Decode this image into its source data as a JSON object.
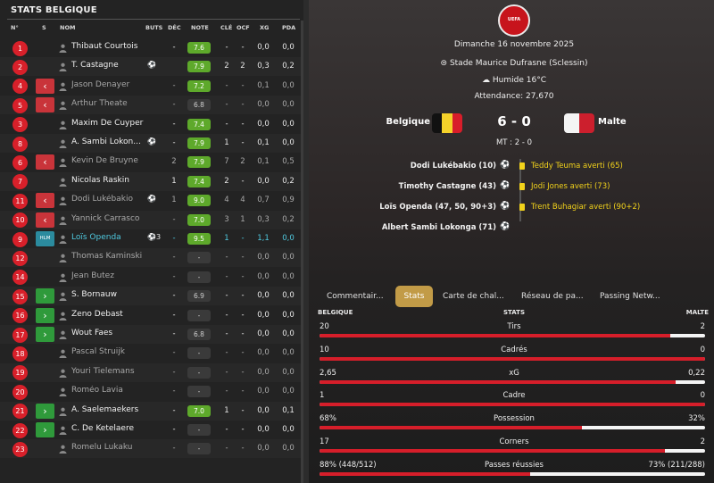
{
  "left_panel": {
    "title": "STATS BELGIQUE",
    "columns": {
      "num": "N°",
      "sub": "S",
      "name": "NOM",
      "buts": "BUTS",
      "dec": "DÉC",
      "note": "NOTE",
      "cle": "CLÉ",
      "ocf": "OCF",
      "xg": "XG",
      "pda": "PDA"
    },
    "players": [
      {
        "num": "1",
        "sub": "",
        "name": "Thibaut Courtois",
        "buts": "",
        "dec": "-",
        "note": "7.6",
        "note_style": "green",
        "cle": "-",
        "ocf": "-",
        "xg": "0,0",
        "pda": "0,0",
        "state": "normal"
      },
      {
        "num": "2",
        "sub": "",
        "name": "T. Castagne",
        "buts": "⚽",
        "dec": "",
        "note": "7.9",
        "note_style": "green",
        "cle": "2",
        "ocf": "2",
        "xg": "0,3",
        "pda": "0,2",
        "state": "normal"
      },
      {
        "num": "4",
        "sub": "out",
        "name": "Jason Denayer",
        "buts": "",
        "dec": "-",
        "note": "7.2",
        "note_style": "green",
        "cle": "-",
        "ocf": "-",
        "xg": "0,1",
        "pda": "0,0",
        "state": "dim"
      },
      {
        "num": "5",
        "sub": "out",
        "name": "Arthur Theate",
        "buts": "",
        "dec": "-",
        "note": "6.8",
        "note_style": "grey",
        "cle": "-",
        "ocf": "-",
        "xg": "0,0",
        "pda": "0,0",
        "state": "dim"
      },
      {
        "num": "3",
        "sub": "",
        "name": "Maxim De Cuyper",
        "buts": "",
        "dec": "-",
        "note": "7.4",
        "note_style": "green",
        "cle": "-",
        "ocf": "-",
        "xg": "0,0",
        "pda": "0,0",
        "state": "normal"
      },
      {
        "num": "8",
        "sub": "",
        "name": "A. Sambi Lokon...",
        "buts": "⚽",
        "dec": "-",
        "note": "7.9",
        "note_style": "green",
        "cle": "1",
        "ocf": "-",
        "xg": "0,1",
        "pda": "0,0",
        "state": "normal"
      },
      {
        "num": "6",
        "sub": "out",
        "name": "Kevin De Bruyne",
        "buts": "",
        "dec": "2",
        "note": "7.9",
        "note_style": "green",
        "cle": "7",
        "ocf": "2",
        "xg": "0,1",
        "pda": "0,5",
        "state": "dim"
      },
      {
        "num": "7",
        "sub": "",
        "name": "Nicolas Raskin",
        "buts": "",
        "dec": "1",
        "note": "7.4",
        "note_style": "green",
        "cle": "2",
        "ocf": "-",
        "xg": "0,0",
        "pda": "0,2",
        "state": "normal"
      },
      {
        "num": "11",
        "sub": "out",
        "name": "Dodi Lukébakio",
        "buts": "⚽",
        "dec": "1",
        "note": "9.0",
        "note_style": "green",
        "cle": "4",
        "ocf": "4",
        "xg": "0,7",
        "pda": "0,9",
        "state": "dim"
      },
      {
        "num": "10",
        "sub": "out",
        "name": "Yannick Carrasco",
        "buts": "",
        "dec": "-",
        "note": "7.0",
        "note_style": "green",
        "cle": "3",
        "ocf": "1",
        "xg": "0,3",
        "pda": "0,2",
        "state": "dim"
      },
      {
        "num": "9",
        "sub": "hm",
        "name": "Loïs Openda",
        "buts": "⚽3",
        "dec": "-",
        "note": "9.5",
        "note_style": "green",
        "cle": "1",
        "ocf": "-",
        "xg": "1,1",
        "pda": "0,0",
        "state": "hl"
      },
      {
        "num": "12",
        "sub": "",
        "name": "Thomas Kaminski",
        "buts": "",
        "dec": "-",
        "note": "-",
        "note_style": "grey",
        "cle": "-",
        "ocf": "-",
        "xg": "0,0",
        "pda": "0,0",
        "state": "dim"
      },
      {
        "num": "14",
        "sub": "",
        "name": "Jean Butez",
        "buts": "",
        "dec": "-",
        "note": "-",
        "note_style": "grey",
        "cle": "-",
        "ocf": "-",
        "xg": "0,0",
        "pda": "0,0",
        "state": "dim"
      },
      {
        "num": "15",
        "sub": "in",
        "name": "S. Bornauw",
        "buts": "",
        "dec": "-",
        "note": "6.9",
        "note_style": "grey",
        "cle": "-",
        "ocf": "-",
        "xg": "0,0",
        "pda": "0,0",
        "state": "normal"
      },
      {
        "num": "16",
        "sub": "in",
        "name": "Zeno Debast",
        "buts": "",
        "dec": "-",
        "note": "-",
        "note_style": "grey",
        "cle": "-",
        "ocf": "-",
        "xg": "0,0",
        "pda": "0,0",
        "state": "normal"
      },
      {
        "num": "17",
        "sub": "in",
        "name": "Wout Faes",
        "buts": "",
        "dec": "-",
        "note": "6.8",
        "note_style": "grey",
        "cle": "-",
        "ocf": "-",
        "xg": "0,0",
        "pda": "0,0",
        "state": "normal"
      },
      {
        "num": "18",
        "sub": "",
        "name": "Pascal Struijk",
        "buts": "",
        "dec": "-",
        "note": "-",
        "note_style": "grey",
        "cle": "-",
        "ocf": "-",
        "xg": "0,0",
        "pda": "0,0",
        "state": "dim"
      },
      {
        "num": "19",
        "sub": "",
        "name": "Youri Tielemans",
        "buts": "",
        "dec": "-",
        "note": "-",
        "note_style": "grey",
        "cle": "-",
        "ocf": "-",
        "xg": "0,0",
        "pda": "0,0",
        "state": "dim"
      },
      {
        "num": "20",
        "sub": "",
        "name": "Roméo Lavia",
        "buts": "",
        "dec": "-",
        "note": "-",
        "note_style": "grey",
        "cle": "-",
        "ocf": "-",
        "xg": "0,0",
        "pda": "0,0",
        "state": "dim"
      },
      {
        "num": "21",
        "sub": "in",
        "name": "A. Saelemaekers",
        "buts": "",
        "dec": "-",
        "note": "7.0",
        "note_style": "green",
        "cle": "1",
        "ocf": "-",
        "xg": "0,0",
        "pda": "0,1",
        "state": "normal"
      },
      {
        "num": "22",
        "sub": "in",
        "name": "C. De Ketelaere",
        "buts": "",
        "dec": "-",
        "note": "-",
        "note_style": "grey",
        "cle": "-",
        "ocf": "-",
        "xg": "0,0",
        "pda": "0,0",
        "state": "normal"
      },
      {
        "num": "23",
        "sub": "",
        "name": "Romelu Lukaku",
        "buts": "",
        "dec": "-",
        "note": "-",
        "note_style": "grey",
        "cle": "-",
        "ocf": "-",
        "xg": "0,0",
        "pda": "0,0",
        "state": "dim"
      }
    ],
    "sub_labels": {
      "out": "‹",
      "in": "›",
      "hm": "HLM"
    }
  },
  "match": {
    "badge": "UEFA",
    "date": "Dimanche 16 novembre 2025",
    "venue": "Stade Maurice Dufrasne (Sclessin)",
    "weather": "Humide 16°C",
    "attendance": "Attendance: 27,670",
    "home": "Belgique",
    "away": "Malte",
    "score": "6 - 0",
    "halftime": "MT : 2 - 0",
    "colors": {
      "be_black": "#111111",
      "be_yellow": "#f5d22a",
      "be_red": "#d81d2a",
      "mt_white": "#f4f4f4",
      "mt_red": "#cc1f2d"
    },
    "goals": [
      "Dodi Lukébakio (10)",
      "Timothy Castagne (43)",
      "Loïs Openda (47, 50, 90+3)",
      "Albert Sambi Lokonga (71)"
    ],
    "bookings": [
      "Teddy Teuma averti (65)",
      "Jodi Jones averti (73)",
      "Trent Buhagiar averti (90+2)"
    ]
  },
  "tabs": [
    "Commentair...",
    "Stats",
    "Carte de chal...",
    "Réseau de pa...",
    "Passing Netw..."
  ],
  "active_tab": "Stats",
  "stats": {
    "home_header": "BELGIQUE",
    "mid_header": "STATS",
    "away_header": "MALTE",
    "rows": [
      {
        "label": "Tirs",
        "home": "20",
        "away": "2",
        "home_share": 0.909
      },
      {
        "label": "Cadrés",
        "home": "10",
        "away": "0",
        "home_share": 1.0
      },
      {
        "label": "xG",
        "home": "2,65",
        "away": "0,22",
        "home_share": 0.923
      },
      {
        "label": "Cadre",
        "home": "1",
        "away": "0",
        "home_share": 1.0
      },
      {
        "label": "Possession",
        "home": "68%",
        "away": "32%",
        "home_share": 0.68
      },
      {
        "label": "Corners",
        "home": "17",
        "away": "2",
        "home_share": 0.895
      },
      {
        "label": "Passes réussies",
        "home": "88% (448/512)",
        "away": "73% (211/288)",
        "home_share": 0.547
      }
    ]
  },
  "accent_colors": {
    "rating_green": "#5ea92b",
    "number_red": "#d8202a",
    "tab_gold": "#c29b47",
    "bar_red": "#d61e2a",
    "booking_yellow": "#f2d21b",
    "highlight_cyan": "#4fc9df"
  }
}
